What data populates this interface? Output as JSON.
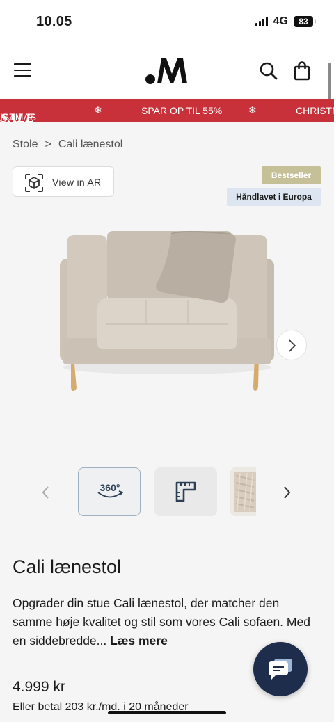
{
  "status_bar": {
    "time": "10.05",
    "network": "4G",
    "battery": "83"
  },
  "header": {
    "logo_text": ".M"
  },
  "banner": {
    "items": [
      "ISTMAS",
      "SALE",
      "SPAR OP TIL 55%",
      "CHRISTM"
    ],
    "separator_icon": "snowflake-icon",
    "background": "#c8303a"
  },
  "breadcrumb": {
    "parent": "Stole",
    "separator": ">",
    "current": "Cali lænestol"
  },
  "ar_button": {
    "label": "View in AR"
  },
  "badges": {
    "bestseller": "Bestseller",
    "handmade": "Håndlavet i Europa"
  },
  "thumbnails": [
    {
      "label": "360°",
      "icon": "360-rotate-icon"
    },
    {
      "icon": "ruler-dimensions-icon"
    },
    {
      "icon": "fabric-swatch"
    }
  ],
  "product": {
    "title": "Cali lænestol",
    "description": "Opgrader din stue Cali lænestol, der matcher den samme høje kvalitet og stil som vores Cali sofaen. Med en siddebredde...",
    "read_more": "Læs mere",
    "price": "4.999 kr",
    "installment": "Eller betal 203 kr./md. i 20 måneder"
  },
  "colors": {
    "accent_navy": "#1f2d4d",
    "badge_gold": "#c6c098",
    "badge_blue": "#dde6f0"
  }
}
